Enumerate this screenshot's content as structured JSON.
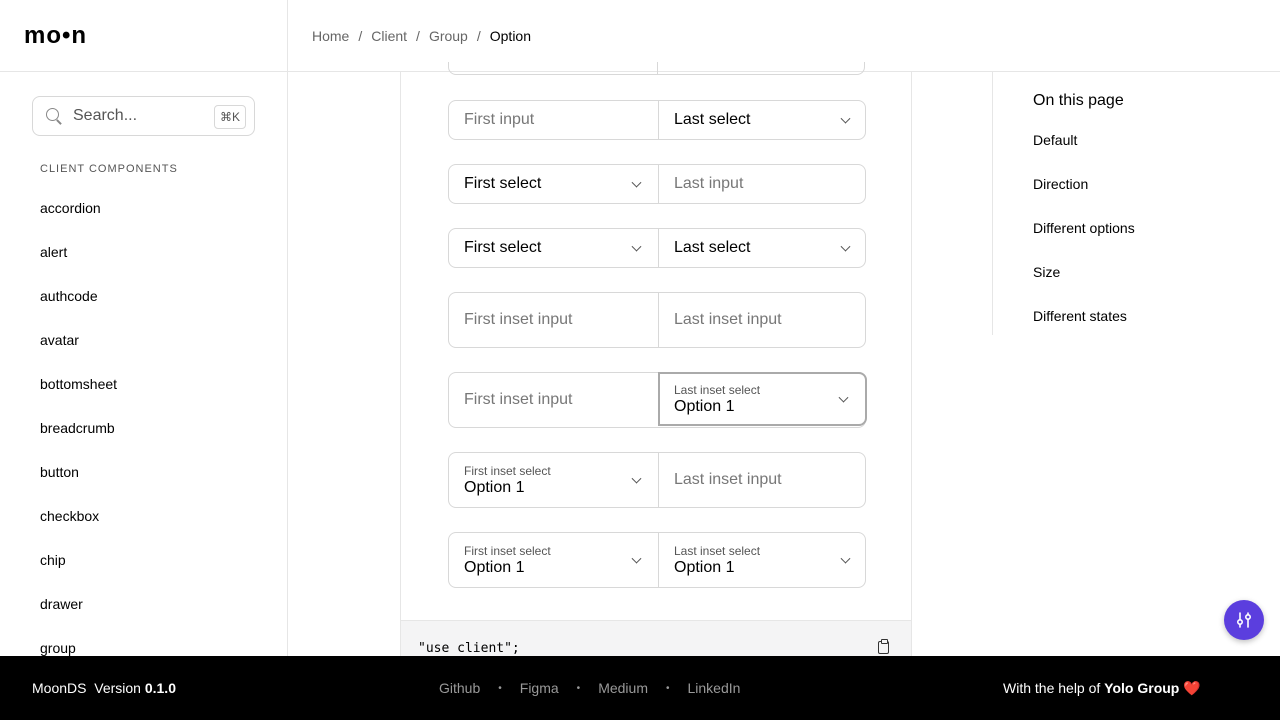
{
  "logo": "mo•n",
  "breadcrumb": [
    "Home",
    "Client",
    "Group",
    "Option"
  ],
  "breadcrumb_separator": "/",
  "search": {
    "placeholder": "Search...",
    "shortcut": "⌘K"
  },
  "sidebar": {
    "section_title": "CLIENT COMPONENTS",
    "items": [
      "accordion",
      "alert",
      "authcode",
      "avatar",
      "bottomsheet",
      "breadcrumb",
      "button",
      "checkbox",
      "chip",
      "drawer",
      "group"
    ]
  },
  "demo": {
    "row1": {
      "first": "First input",
      "last": "Last select"
    },
    "row2": {
      "first": "First select",
      "last": "Last input"
    },
    "row3": {
      "first": "First select",
      "last": "Last select"
    },
    "row4": {
      "first": "First inset input",
      "last": "Last inset input"
    },
    "row5": {
      "first": "First inset input",
      "last_label": "Last inset select",
      "last_value": "Option 1"
    },
    "row6": {
      "first_label": "First inset select",
      "first_value": "Option 1",
      "last": "Last inset input"
    },
    "row7": {
      "first_label": "First inset select",
      "first_value": "Option 1",
      "last_label": "Last inset select",
      "last_value": "Option 1"
    }
  },
  "code": "\"use client\";",
  "toc": {
    "title": "On this page",
    "items": [
      "Default",
      "Direction",
      "Different options",
      "Size",
      "Different states"
    ]
  },
  "footer": {
    "brand": "MoonDS",
    "version_label": "Version",
    "version": "0.1.0",
    "links": [
      "Github",
      "Figma",
      "Medium",
      "LinkedIn"
    ],
    "link_separator": "•",
    "credit_prefix": "With the help of",
    "credit_name": "Yolo Group",
    "credit_heart": "❤️"
  },
  "colors": {
    "accent": "#5b3ede",
    "footer_bg": "#000000",
    "border": "#d8d8d8"
  }
}
